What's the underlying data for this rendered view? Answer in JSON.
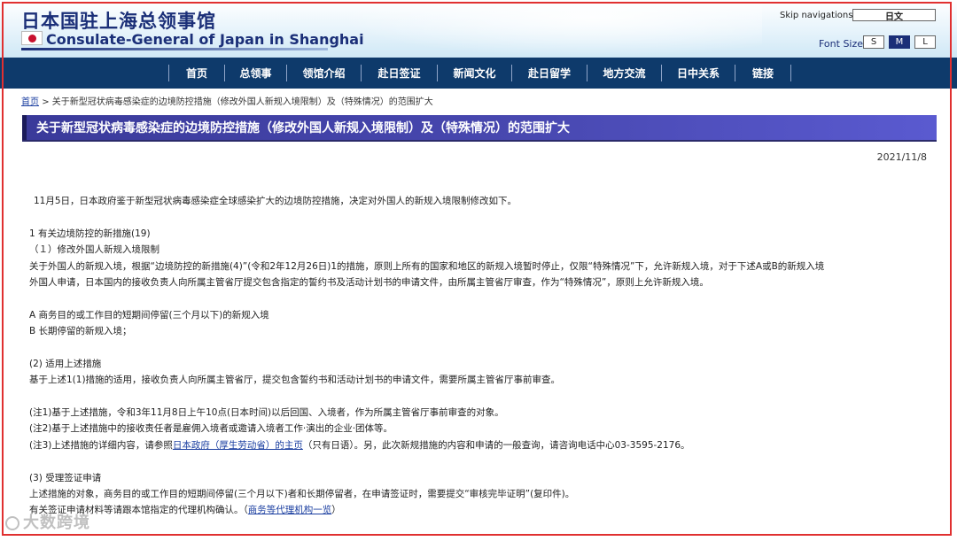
{
  "header": {
    "title_cn": "日本国驻上海总领事馆",
    "title_en": "Consulate-General of Japan in Shanghai",
    "skip_nav": "Skip navigations",
    "lang_button": "日文",
    "font_size_label": "Font Size",
    "font_sizes": [
      "S",
      "M",
      "L"
    ],
    "font_size_selected": "M"
  },
  "nav": {
    "items": [
      "首页",
      "总领事",
      "领馆介绍",
      "赴日签证",
      "新闻文化",
      "赴日留学",
      "地方交流",
      "日中关系",
      "链接"
    ]
  },
  "breadcrumb": {
    "home": "首页",
    "separator": ">",
    "current": "关于新型冠状病毒感染症的边境防控措施（修改外国人新规入境限制）及（特殊情况）的范围扩大"
  },
  "page": {
    "title": "关于新型冠状病毒感染症的边境防控措施（修改外国人新规入境限制）及（特殊情况）的范围扩大",
    "date": "2021/11/8"
  },
  "content": {
    "intro": "11月5日，日本政府鉴于新型冠状病毒感染症全球感染扩大的边境防控措施，决定对外国人的新规入境限制修改如下。",
    "s1_heading": "1 有关边境防控的新措施(19)",
    "s1_sub": "（１）修改外国人新规入境限制",
    "s1_p1": "关于外国人的新规入境，根据“边境防控的新措施(4)”(令和2年12月26日)1的措施，原则上所有的国家和地区的新规入境暂时停止，仅限“特殊情况”下，允许新规入境，对于下述A或B的新规入境",
    "s1_p2": "外国人申请，日本国内的接收负责人向所属主管省厅提交包含指定的誓约书及活动计划书的申请文件，由所属主管省厅审查，作为“特殊情况”，原则上允许新规入境。",
    "item_a": "A 商务目的或工作目的短期间停留(三个月以下)的新规入境",
    "item_b": "B 长期停留的新规入境；",
    "s2_heading": "(2) 适用上述措施",
    "s2_p": "基于上述1(1)措施的适用，接收负责人向所属主管省厅，提交包含誓约书和活动计划书的申请文件，需要所属主管省厅事前审查。",
    "note1": "(注1)基于上述措施，令和3年11月8日上午10点(日本时间)以后回国、入境者，作为所属主管省厅事前审查的对象。",
    "note2": "(注2)基于上述措施中的接收责任者是雇佣入境者或邀请入境者工作·演出的企业·团体等。",
    "note3_pre": "(注3)上述措施的详细内容，请参照",
    "note3_link": "日本政府（厚生劳动省）的主页",
    "note3_post": "（只有日语）。另，此次新规措施的内容和申请的一般查询，请咨询电话中心03-3595-2176。",
    "s3_heading": "(3) 受理签证申请",
    "s3_p1": "上述措施的对象，商务目的或工作目的短期间停留(三个月以下)者和长期停留者，在申请签证时，需要提交“审核完毕证明”(复印件)。",
    "s3_p2_pre": "有关签证申请材料等请跟本馆指定的代理机构确认。（",
    "s3_p2_link": "商务等代理机构一览",
    "s3_p2_post": "）"
  },
  "watermark": "大数跨境",
  "colors": {
    "nav_bg": "#0e3a6b",
    "title_bar": "#4848b0",
    "brand_text": "#1b2f78",
    "link": "#1a3ea0",
    "frame_border": "#e03030"
  }
}
